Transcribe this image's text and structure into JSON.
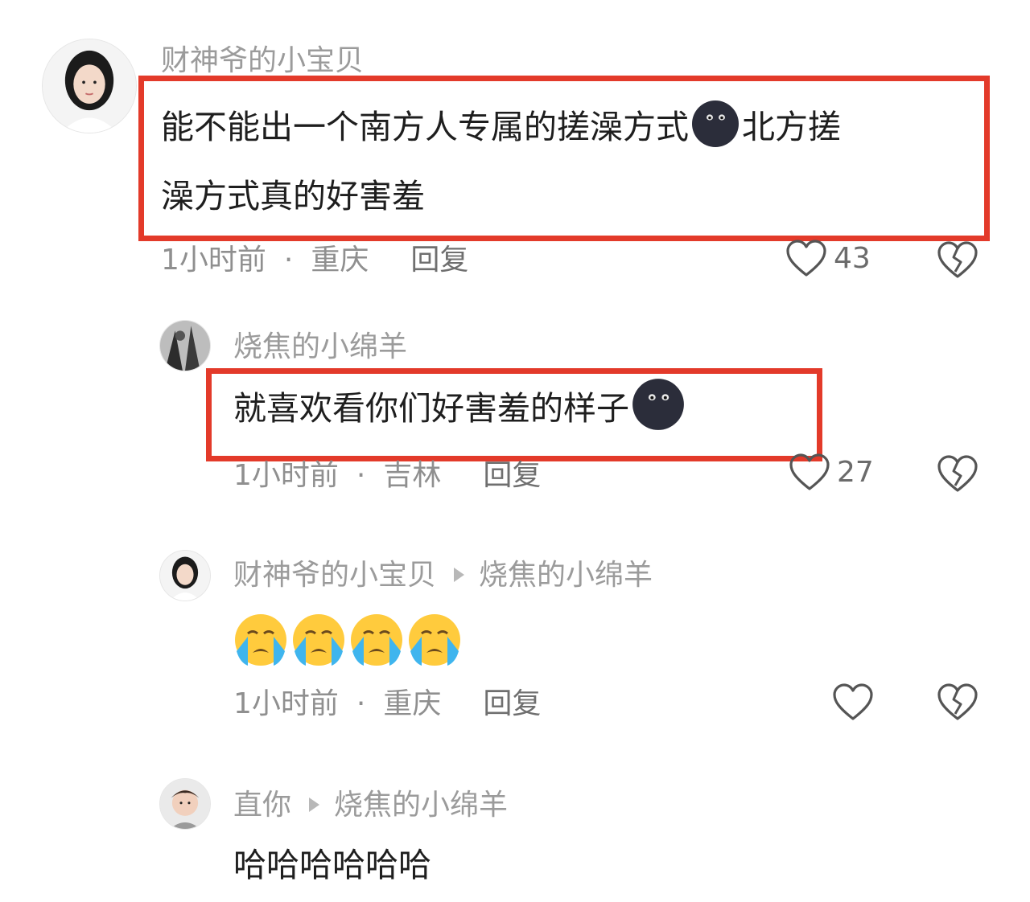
{
  "comments": [
    {
      "username": "财神爷的小宝贝",
      "text_line1_a": "能不能出一个南方人专属的搓澡方式",
      "text_line1_b": "北方搓",
      "text_line2": "澡方式真的好害羞",
      "time": "1小时前",
      "location": "重庆",
      "reply_label": "回复",
      "likes": "43"
    },
    {
      "username": "烧焦的小绵羊",
      "text": "就喜欢看你们好害羞的样子",
      "time": "1小时前",
      "location": "吉林",
      "reply_label": "回复",
      "likes": "27"
    },
    {
      "username": "财神爷的小宝贝",
      "reply_to": "烧焦的小绵羊",
      "time": "1小时前",
      "location": "重庆",
      "reply_label": "回复"
    },
    {
      "username": "直你",
      "reply_to": "烧焦的小绵羊",
      "text": "哈哈哈哈哈哈"
    }
  ],
  "colors": {
    "highlight_box": "#e33a2a",
    "muted_text": "#9b9b9b"
  },
  "icons": [
    "heart-icon",
    "broken-heart-icon",
    "black-face-emoji",
    "crying-face-emoji",
    "reply-arrow-icon"
  ]
}
